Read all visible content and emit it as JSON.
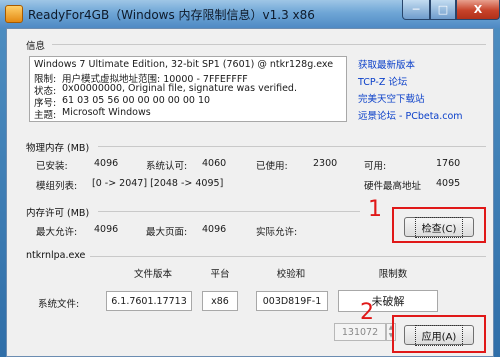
{
  "window": {
    "title": "ReadyFor4GB（Windows 内存限制信息）v1.3 x86",
    "min": "─",
    "max": "□",
    "close": "X"
  },
  "info": {
    "title": "信息",
    "lines": [
      {
        "label": "",
        "value": "Windows 7 Ultimate Edition, 32-bit SP1 (7601) @ ntkr128g.exe"
      },
      {
        "label": "限制:",
        "value": "用户模式虚拟地址范围:   10000 - 7FFEFFFF"
      },
      {
        "label": "状态:",
        "value": "0x00000000, Original file, signature was verified."
      },
      {
        "label": "序号:",
        "value": "61 03 05 56 00 00 00 00 00 10"
      },
      {
        "label": "主题:",
        "value": "Microsoft Windows"
      }
    ],
    "links": [
      "获取最新版本",
      "TCP-Z 论坛",
      "完美天空下载站",
      "远景论坛 - PCbeta.com"
    ]
  },
  "physical": {
    "title": "物理内存 (MB)",
    "installed_label": "已安装:",
    "installed": "4096",
    "system_label": "系统认可:",
    "system": "4060",
    "used_label": "已使用:",
    "used": "2300",
    "available_label": "可用:",
    "available": "1760",
    "modules_label": "模组列表:",
    "modules": "[0 -> 2047]  [2048 -> 4095]",
    "hw_max_label": "硬件最高地址",
    "hw_max": "4095"
  },
  "license": {
    "title": "内存许可 (MB)",
    "max_allowed_label": "最大允许:",
    "max_allowed": "4096",
    "max_page_label": "最大页面:",
    "max_page": "4096",
    "actual_label": "实际允许:",
    "actual": "",
    "check_button": "检查(C)"
  },
  "ntkrnlpa": {
    "title": "ntkrnlpa.exe",
    "headers": [
      "文件版本",
      "平台",
      "校验和",
      "限制数"
    ],
    "row_label": "系统文件:",
    "version": "6.1.7601.17713",
    "platform": "x86",
    "checksum": "003D819F-1",
    "limit": "未破解",
    "spin_value": "131072",
    "apply_button": "应用(A)"
  },
  "annotations": {
    "one": "1",
    "two": "2"
  }
}
